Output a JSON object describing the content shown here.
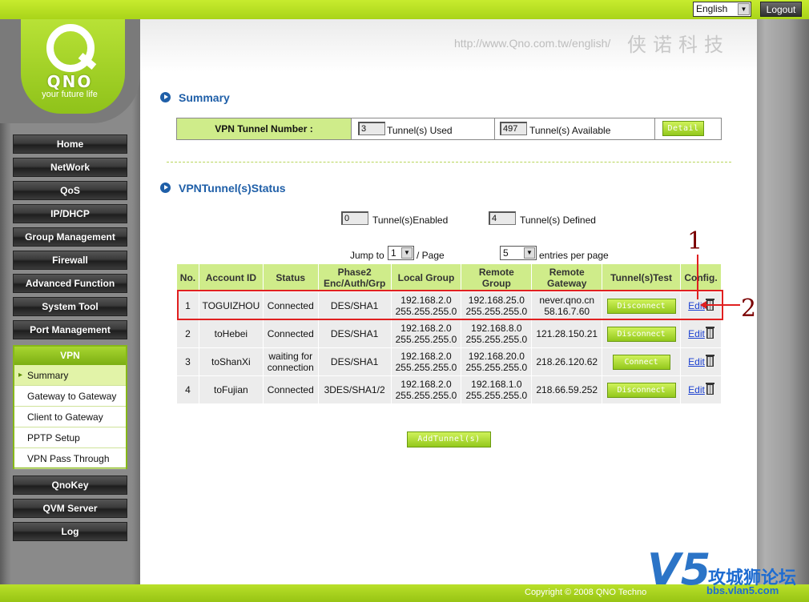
{
  "header": {
    "language": "English",
    "logout_label": "Logout",
    "url_text": "http://www.Qno.com.tw/english/",
    "brand_cn": "侠诺科技"
  },
  "logo": {
    "brand": "QNO",
    "tagline": "your future life"
  },
  "nav": {
    "items": [
      "Home",
      "NetWork",
      "QoS",
      "IP/DHCP",
      "Group Management",
      "Firewall",
      "Advanced Function",
      "System Tool",
      "Port Management"
    ],
    "vpn_label": "VPN",
    "vpn_items": [
      "Summary",
      "Gateway to Gateway",
      "Client to Gateway",
      "PPTP Setup",
      "VPN Pass Through"
    ],
    "bottom_items": [
      "QnoKey",
      "QVM Server",
      "Log"
    ]
  },
  "summary": {
    "title": "Summary",
    "label": "VPN Tunnel Number :",
    "used_value": "3",
    "used_text": "Tunnel(s) Used",
    "available_value": "497",
    "available_text": "Tunnel(s) Available",
    "detail_label": "Detail"
  },
  "status": {
    "title": "VPNTunnel(s)Status",
    "enabled_value": "0",
    "enabled_text": "Tunnel(s)Enabled",
    "defined_value": "4",
    "defined_text": "Tunnel(s) Defined",
    "jump_label": "Jump to",
    "page_value": "1",
    "page_suffix": "/  Page",
    "per_page_value": "5",
    "per_page_text": "entries per page"
  },
  "table": {
    "headers": {
      "no": "No.",
      "account": "Account ID",
      "status": "Status",
      "phase2_a": "Phase2",
      "phase2_b": "Enc/Auth/Grp",
      "local": "Local Group",
      "remote_a": "Remote",
      "remote_b": "Group",
      "gw_a": "Remote",
      "gw_b": "Gateway",
      "test": "Tunnel(s)Test",
      "config": "Config."
    },
    "edit_label": "Edit",
    "rows": [
      {
        "no": "1",
        "account": "TOGUIZHOU",
        "status": "Connected",
        "status2": "",
        "phase2": "DES/SHA1",
        "local_ip": "192.168.2.0",
        "local_mask": "255.255.255.0",
        "remote_ip": "192.168.25.0",
        "remote_mask": "255.255.255.0",
        "gateway": "never.qno.cn",
        "gateway2": "58.16.7.60",
        "test_label": "Disconnect"
      },
      {
        "no": "2",
        "account": "toHebei",
        "status": "Connected",
        "status2": "",
        "phase2": "DES/SHA1",
        "local_ip": "192.168.2.0",
        "local_mask": "255.255.255.0",
        "remote_ip": "192.168.8.0",
        "remote_mask": "255.255.255.0",
        "gateway": "121.28.150.21",
        "gateway2": "",
        "test_label": "Disconnect"
      },
      {
        "no": "3",
        "account": "toShanXi",
        "status": "waiting for",
        "status2": "connection",
        "phase2": "DES/SHA1",
        "local_ip": "192.168.2.0",
        "local_mask": "255.255.255.0",
        "remote_ip": "192.168.20.0",
        "remote_mask": "255.255.255.0",
        "gateway": "218.26.120.62",
        "gateway2": "",
        "test_label": "Connect"
      },
      {
        "no": "4",
        "account": "toFujian",
        "status": "Connected",
        "status2": "",
        "phase2": "3DES/SHA1/2",
        "local_ip": "192.168.2.0",
        "local_mask": "255.255.255.0",
        "remote_ip": "192.168.1.0",
        "remote_mask": "255.255.255.0",
        "gateway": "218.66.59.252",
        "gateway2": "",
        "test_label": "Disconnect"
      }
    ],
    "add_label": "AddTunnel(s)"
  },
  "annotations": {
    "one": "1",
    "two": "2"
  },
  "footer": {
    "copyright": "Copyright © 2008 QNO Techno"
  },
  "watermark": {
    "logo": "V5",
    "cn": "攻城狮论坛",
    "url": "bbs.vlan5.com"
  }
}
